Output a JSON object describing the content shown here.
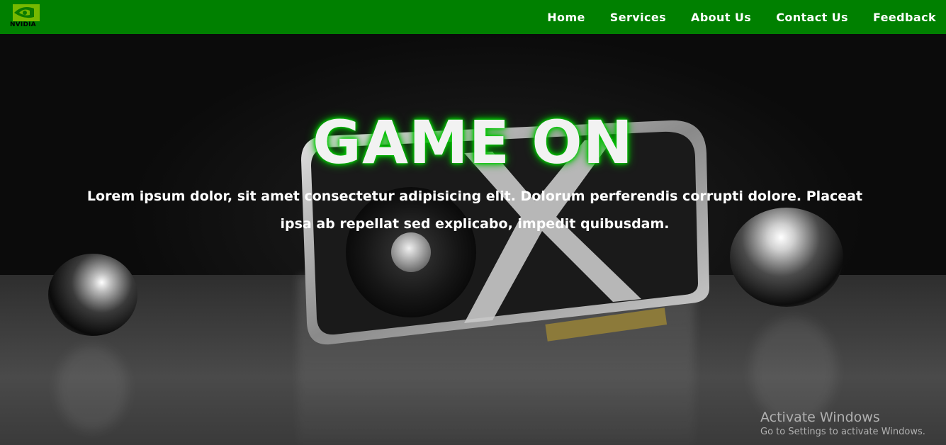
{
  "brand": {
    "logo_text": "NVIDIA",
    "color": "#008000",
    "icon": "nvidia-eye-icon"
  },
  "nav": {
    "items": [
      {
        "label": "Home"
      },
      {
        "label": "Services"
      },
      {
        "label": "About Us"
      },
      {
        "label": "Contact Us"
      },
      {
        "label": "Feedback"
      }
    ]
  },
  "hero": {
    "title": "GAME ON",
    "title_glow_color": "#00c800",
    "text": "Lorem ipsum dolor, sit amet consectetur adipisicing elit. Dolorum perferendis corrupti dolore. Placeat ipsa ab repellat sed explicabo, impedit quibusdam.",
    "background_image": "graphics-card-with-chrome-spheres"
  },
  "watermark": {
    "title": "Activate Windows",
    "subtitle": "Go to Settings to activate Windows."
  }
}
